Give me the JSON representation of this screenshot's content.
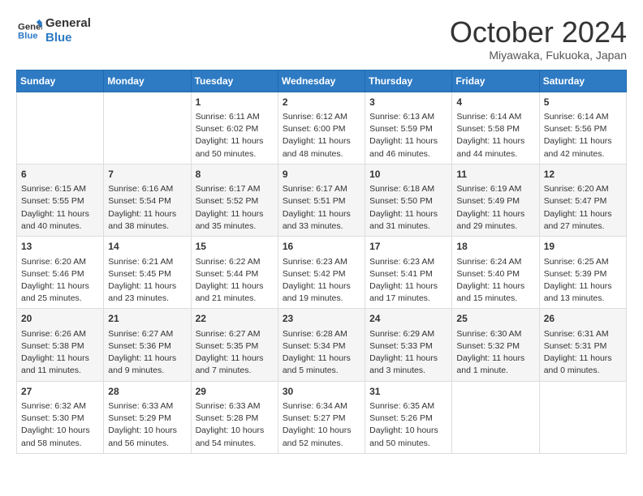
{
  "logo": {
    "line1": "General",
    "line2": "Blue"
  },
  "title": "October 2024",
  "subtitle": "Miyawaka, Fukuoka, Japan",
  "days_of_week": [
    "Sunday",
    "Monday",
    "Tuesday",
    "Wednesday",
    "Thursday",
    "Friday",
    "Saturday"
  ],
  "weeks": [
    [
      {
        "day": "",
        "info": ""
      },
      {
        "day": "",
        "info": ""
      },
      {
        "day": "1",
        "info": "Sunrise: 6:11 AM\nSunset: 6:02 PM\nDaylight: 11 hours and 50 minutes."
      },
      {
        "day": "2",
        "info": "Sunrise: 6:12 AM\nSunset: 6:00 PM\nDaylight: 11 hours and 48 minutes."
      },
      {
        "day": "3",
        "info": "Sunrise: 6:13 AM\nSunset: 5:59 PM\nDaylight: 11 hours and 46 minutes."
      },
      {
        "day": "4",
        "info": "Sunrise: 6:14 AM\nSunset: 5:58 PM\nDaylight: 11 hours and 44 minutes."
      },
      {
        "day": "5",
        "info": "Sunrise: 6:14 AM\nSunset: 5:56 PM\nDaylight: 11 hours and 42 minutes."
      }
    ],
    [
      {
        "day": "6",
        "info": "Sunrise: 6:15 AM\nSunset: 5:55 PM\nDaylight: 11 hours and 40 minutes."
      },
      {
        "day": "7",
        "info": "Sunrise: 6:16 AM\nSunset: 5:54 PM\nDaylight: 11 hours and 38 minutes."
      },
      {
        "day": "8",
        "info": "Sunrise: 6:17 AM\nSunset: 5:52 PM\nDaylight: 11 hours and 35 minutes."
      },
      {
        "day": "9",
        "info": "Sunrise: 6:17 AM\nSunset: 5:51 PM\nDaylight: 11 hours and 33 minutes."
      },
      {
        "day": "10",
        "info": "Sunrise: 6:18 AM\nSunset: 5:50 PM\nDaylight: 11 hours and 31 minutes."
      },
      {
        "day": "11",
        "info": "Sunrise: 6:19 AM\nSunset: 5:49 PM\nDaylight: 11 hours and 29 minutes."
      },
      {
        "day": "12",
        "info": "Sunrise: 6:20 AM\nSunset: 5:47 PM\nDaylight: 11 hours and 27 minutes."
      }
    ],
    [
      {
        "day": "13",
        "info": "Sunrise: 6:20 AM\nSunset: 5:46 PM\nDaylight: 11 hours and 25 minutes."
      },
      {
        "day": "14",
        "info": "Sunrise: 6:21 AM\nSunset: 5:45 PM\nDaylight: 11 hours and 23 minutes."
      },
      {
        "day": "15",
        "info": "Sunrise: 6:22 AM\nSunset: 5:44 PM\nDaylight: 11 hours and 21 minutes."
      },
      {
        "day": "16",
        "info": "Sunrise: 6:23 AM\nSunset: 5:42 PM\nDaylight: 11 hours and 19 minutes."
      },
      {
        "day": "17",
        "info": "Sunrise: 6:23 AM\nSunset: 5:41 PM\nDaylight: 11 hours and 17 minutes."
      },
      {
        "day": "18",
        "info": "Sunrise: 6:24 AM\nSunset: 5:40 PM\nDaylight: 11 hours and 15 minutes."
      },
      {
        "day": "19",
        "info": "Sunrise: 6:25 AM\nSunset: 5:39 PM\nDaylight: 11 hours and 13 minutes."
      }
    ],
    [
      {
        "day": "20",
        "info": "Sunrise: 6:26 AM\nSunset: 5:38 PM\nDaylight: 11 hours and 11 minutes."
      },
      {
        "day": "21",
        "info": "Sunrise: 6:27 AM\nSunset: 5:36 PM\nDaylight: 11 hours and 9 minutes."
      },
      {
        "day": "22",
        "info": "Sunrise: 6:27 AM\nSunset: 5:35 PM\nDaylight: 11 hours and 7 minutes."
      },
      {
        "day": "23",
        "info": "Sunrise: 6:28 AM\nSunset: 5:34 PM\nDaylight: 11 hours and 5 minutes."
      },
      {
        "day": "24",
        "info": "Sunrise: 6:29 AM\nSunset: 5:33 PM\nDaylight: 11 hours and 3 minutes."
      },
      {
        "day": "25",
        "info": "Sunrise: 6:30 AM\nSunset: 5:32 PM\nDaylight: 11 hours and 1 minute."
      },
      {
        "day": "26",
        "info": "Sunrise: 6:31 AM\nSunset: 5:31 PM\nDaylight: 11 hours and 0 minutes."
      }
    ],
    [
      {
        "day": "27",
        "info": "Sunrise: 6:32 AM\nSunset: 5:30 PM\nDaylight: 10 hours and 58 minutes."
      },
      {
        "day": "28",
        "info": "Sunrise: 6:33 AM\nSunset: 5:29 PM\nDaylight: 10 hours and 56 minutes."
      },
      {
        "day": "29",
        "info": "Sunrise: 6:33 AM\nSunset: 5:28 PM\nDaylight: 10 hours and 54 minutes."
      },
      {
        "day": "30",
        "info": "Sunrise: 6:34 AM\nSunset: 5:27 PM\nDaylight: 10 hours and 52 minutes."
      },
      {
        "day": "31",
        "info": "Sunrise: 6:35 AM\nSunset: 5:26 PM\nDaylight: 10 hours and 50 minutes."
      },
      {
        "day": "",
        "info": ""
      },
      {
        "day": "",
        "info": ""
      }
    ]
  ]
}
